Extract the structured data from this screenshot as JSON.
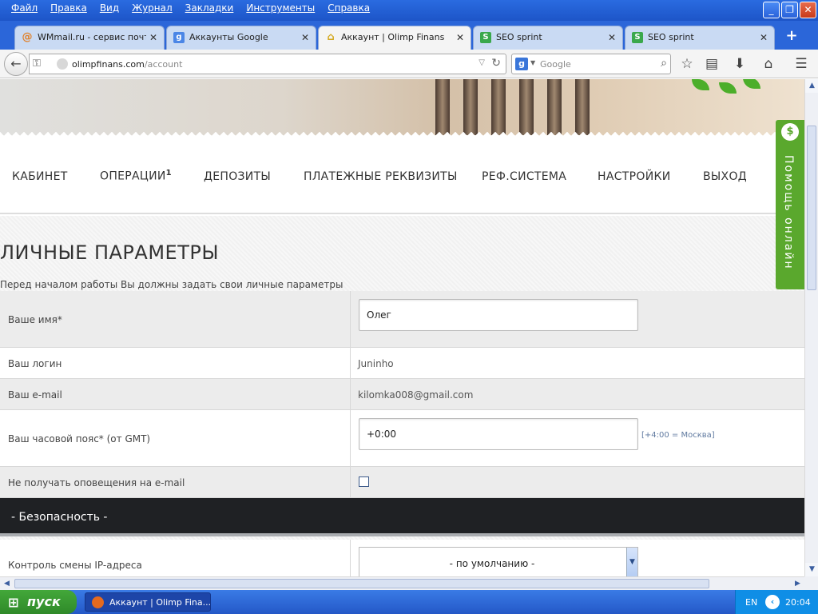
{
  "window": {
    "menu": [
      "Файл",
      "Правка",
      "Вид",
      "Журнал",
      "Закладки",
      "Инструменты",
      "Справка"
    ],
    "controls": {
      "minimize": "_",
      "maximize": "❐",
      "close": "✕"
    }
  },
  "tabs": [
    {
      "label": "WMmail.ru - сервис почт...",
      "icon": "at-sign-icon",
      "icon_color": "#e0812a",
      "active": false
    },
    {
      "label": "Аккаунты Google",
      "icon": "google-icon",
      "icon_color": "#4b86e6",
      "active": false
    },
    {
      "label": "Аккаунт | Olimp Finans",
      "icon": "temple-icon",
      "icon_color": "#d4a81e",
      "active": true
    },
    {
      "label": "SEO sprint",
      "icon": "seo-sprint-icon",
      "icon_color": "#3aa84c",
      "active": false
    },
    {
      "label": "SEO sprint",
      "icon": "seo-sprint-icon",
      "icon_color": "#3aa84c",
      "active": false
    }
  ],
  "address_bar": {
    "domain": "olimpfinans.com",
    "path": "/account",
    "search_placeholder": "Google"
  },
  "site_nav": [
    {
      "label": "КАБИНЕТ",
      "sup": ""
    },
    {
      "label": "ОПЕРАЦИИ",
      "sup": "1"
    },
    {
      "label": "ДЕПОЗИТЫ",
      "sup": ""
    },
    {
      "label": "ПЛАТЕЖНЫЕ РЕКВИЗИТЫ",
      "sup": ""
    },
    {
      "label": "РЕФ.СИСТЕМА",
      "sup": ""
    },
    {
      "label": "НАСТРОЙКИ",
      "sup": ""
    },
    {
      "label": "ВЫХОД",
      "sup": ""
    }
  ],
  "page": {
    "title": "ЛИЧНЫЕ ПАРАМЕТРЫ",
    "subtitle": "Перед началом работы Вы должны задать свои личные параметры"
  },
  "form": {
    "name_label": "Ваше имя*",
    "name_value": "Олег",
    "login_label": "Ваш логин",
    "login_value": "Juninho",
    "email_label": "Ваш e-mail",
    "email_value": "kilomka008@gmail.com",
    "tz_label": "Ваш часовой пояс* (от GMT)",
    "tz_value": "+0:00",
    "tz_hint": "[+4:00 = Москва]",
    "no_notify_label": "Не получать оповещения на e-mail",
    "no_notify_checked": false
  },
  "security": {
    "section_title": "- Безопасность -",
    "ip_control_label": "Контроль смены IP-адреса",
    "ip_control_value": "- по умолчанию -"
  },
  "help_widget": {
    "label": "Помощь онлайн",
    "color": "#5aa82d"
  },
  "taskbar": {
    "start_label": "пуск",
    "window_item": "Аккаунт | Olimp Fina...",
    "language": "EN",
    "clock": "20:04"
  }
}
